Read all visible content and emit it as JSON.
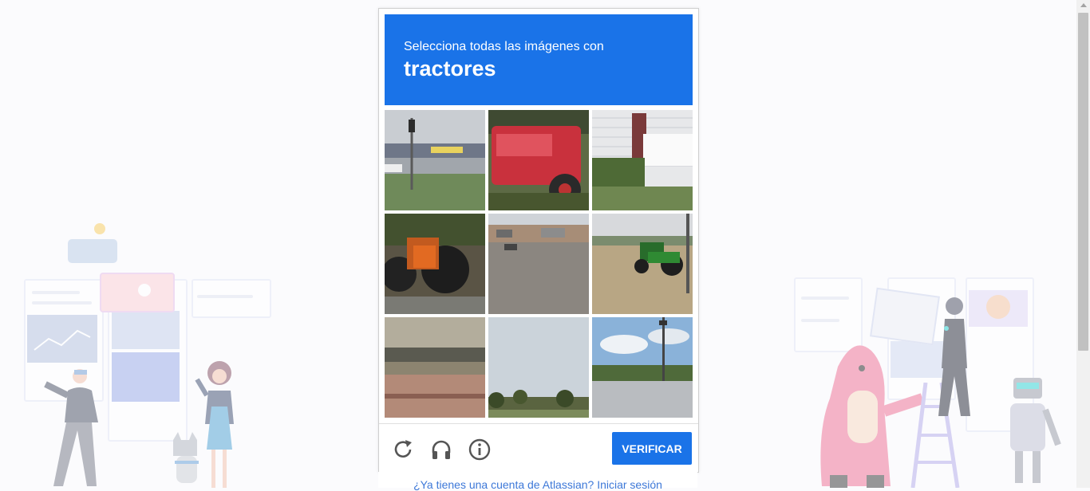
{
  "captcha": {
    "instruction": "Selecciona todas las imágenes con",
    "keyword": "tractores",
    "tiles": [
      {
        "description": "calle"
      },
      {
        "description": "tractor-rojo"
      },
      {
        "description": "casa"
      },
      {
        "description": "tractor-naranja"
      },
      {
        "description": "estacionamiento"
      },
      {
        "description": "tractor-verde"
      },
      {
        "description": "puente"
      },
      {
        "description": "cielo"
      },
      {
        "description": "carretera"
      }
    ],
    "verify_label": "VERIFICAR",
    "icons": {
      "reload": "reload-icon",
      "audio": "headphones-icon",
      "info": "info-icon"
    },
    "accent_color": "#1a73e8"
  },
  "footer": {
    "login_text": "¿Ya tienes una cuenta de Atlassian? Iniciar sesión"
  }
}
